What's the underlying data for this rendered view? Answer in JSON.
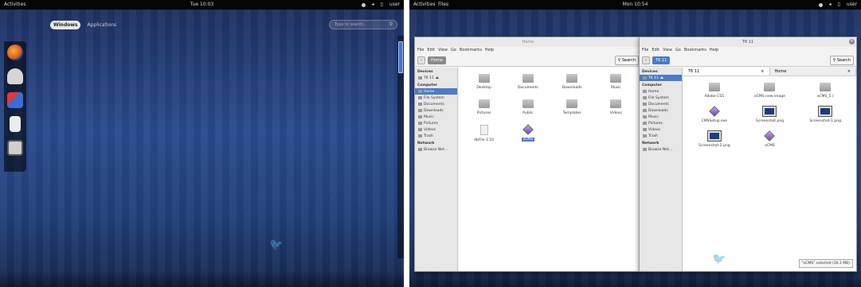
{
  "left": {
    "topbar": {
      "activities": "Activities",
      "clock": "Tue 10:03",
      "user": "user"
    },
    "overview": {
      "tab_windows": "Windows",
      "tab_applications": "Applications",
      "search_placeholder": "Type to search..."
    },
    "dash_icons": [
      "firefox-icon",
      "cloud-icon",
      "screenshot-app-icon",
      "file-manager-icon",
      "camera-icon"
    ]
  },
  "right": {
    "topbar": {
      "activities": "Activities",
      "app": "Files",
      "clock": "Mon 10:54",
      "user": "user"
    },
    "win1": {
      "title": "Home",
      "menu": [
        "File",
        "Edit",
        "View",
        "Go",
        "Bookmarks",
        "Help"
      ],
      "crumb": "Home",
      "search": "Search",
      "sidebar": {
        "devices": "Devices",
        "device_items": [
          "T6 11"
        ],
        "computer": "Computer",
        "computer_items": [
          "Home",
          "File System",
          "Documents",
          "Downloads",
          "Music",
          "Pictures",
          "Videos",
          "Trash"
        ],
        "network": "Network",
        "network_items": [
          "Browse Net..."
        ]
      },
      "items": [
        {
          "name": "Desktop",
          "kind": "folder"
        },
        {
          "name": "Documents",
          "kind": "folder"
        },
        {
          "name": "Downloads",
          "kind": "folder"
        },
        {
          "name": "Music",
          "kind": "folder"
        },
        {
          "name": "Pictures",
          "kind": "folder"
        },
        {
          "name": "Public",
          "kind": "folder"
        },
        {
          "name": "Templates",
          "kind": "folder"
        },
        {
          "name": "Videos",
          "kind": "folder"
        },
        {
          "name": "dbFile 1.10",
          "kind": "doc"
        },
        {
          "name": "xCMS",
          "kind": "gem",
          "selected": true
        }
      ]
    },
    "win2": {
      "title": "T6 11",
      "menu": [
        "File",
        "Edit",
        "View",
        "Go",
        "Bookmarks",
        "Help"
      ],
      "crumb": "T6 11",
      "search": "Search",
      "tab1": "T6 11",
      "tab2": "Home",
      "sidebar": {
        "devices": "Devices",
        "device_items": [
          "T6 11"
        ],
        "computer": "Computer",
        "computer_items": [
          "Home",
          "File System",
          "Documents",
          "Downloads",
          "Music",
          "Pictures",
          "Videos",
          "Trash"
        ],
        "network": "Network",
        "network_items": [
          "Browse Net..."
        ]
      },
      "items": [
        {
          "name": "Adobe CS5",
          "kind": "folder"
        },
        {
          "name": "xCMS new image",
          "kind": "folder"
        },
        {
          "name": "xCMS_5.)",
          "kind": "folder"
        },
        {
          "name": "CMSSetup.exe",
          "kind": "gem"
        },
        {
          "name": "Screenshot.png",
          "kind": "shot"
        },
        {
          "name": "Screenshot-1.png",
          "kind": "shot"
        },
        {
          "name": "Screenshot-2.png",
          "kind": "shot"
        },
        {
          "name": "xCMS",
          "kind": "gem"
        }
      ],
      "status": "\"xCMS\" selected (16.1 MB)"
    }
  }
}
